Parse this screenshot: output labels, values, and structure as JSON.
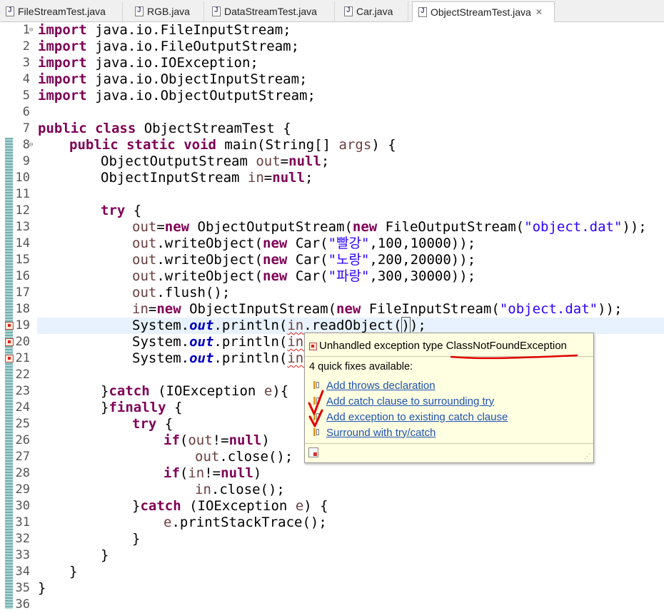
{
  "tabs": [
    {
      "label": "FileStreamTest.java",
      "active": false
    },
    {
      "label": "RGB.java",
      "active": false
    },
    {
      "label": "DataStreamTest.java",
      "active": false
    },
    {
      "label": "Car.java",
      "active": false
    },
    {
      "label": "ObjectStreamTest.java",
      "active": true,
      "close": "✕"
    }
  ],
  "line_numbers": [
    "1",
    "2",
    "3",
    "4",
    "5",
    "6",
    "7",
    "8",
    "9",
    "10",
    "11",
    "12",
    "13",
    "14",
    "15",
    "16",
    "17",
    "18",
    "19",
    "20",
    "21",
    "22",
    "23",
    "24",
    "25",
    "26",
    "27",
    "28",
    "29",
    "30",
    "31",
    "32",
    "33",
    "34",
    "35",
    "36"
  ],
  "code": {
    "l1": [
      "import",
      " java.io.FileInputStream;"
    ],
    "l2": [
      "import",
      " java.io.FileOutputStream;"
    ],
    "l3": [
      "import",
      " java.io.IOException;"
    ],
    "l4": [
      "import",
      " java.io.ObjectInputStream;"
    ],
    "l5": [
      "import",
      " java.io.ObjectOutputStream;"
    ],
    "l7": [
      "public",
      "class",
      " ObjectStreamTest {"
    ],
    "l8": [
      "public",
      "static",
      "void",
      " main(String[] ",
      "args",
      ") {"
    ],
    "l9": [
      "ObjectOutputStream ",
      "out",
      "=",
      "null",
      ";"
    ],
    "l10": [
      "ObjectInputStream ",
      "in",
      "=",
      "null",
      ";"
    ],
    "l12": [
      "try",
      " {"
    ],
    "l13": [
      "out",
      "=",
      "new",
      " ObjectOutputStream(",
      "new",
      " FileOutputStream(",
      "\"object.dat\"",
      "));"
    ],
    "l14": [
      "out",
      ".writeObject(",
      "new",
      " Car(",
      "\"빨강\"",
      ",100,10000));"
    ],
    "l15": [
      "out",
      ".writeObject(",
      "new",
      " Car(",
      "\"노랑\"",
      ",200,20000));"
    ],
    "l16": [
      "out",
      ".writeObject(",
      "new",
      " Car(",
      "\"파랑\"",
      ",300,30000));"
    ],
    "l17": [
      "out",
      ".flush();"
    ],
    "l18": [
      "in",
      "=",
      "new",
      " ObjectInputStream(",
      "new",
      " FileInputStream(",
      "\"object.dat\"",
      "));"
    ],
    "l19": [
      "System.",
      "out",
      ".println(",
      "in",
      ".readObject(",
      ")",
      ");"
    ],
    "l20": [
      "System.",
      "out",
      ".println(",
      "in."
    ],
    "l21": [
      "System.",
      "out",
      ".println(",
      "in."
    ],
    "l23": [
      "}",
      "catch",
      " (IOException ",
      "e",
      "){"
    ],
    "l24": [
      "}",
      "finally",
      " {"
    ],
    "l25": [
      "try",
      " {"
    ],
    "l26": [
      "if",
      "(",
      "out",
      "!=",
      "null",
      ")"
    ],
    "l27": [
      "out",
      ".close();"
    ],
    "l28": [
      "if",
      "(",
      "in",
      "!=",
      "null",
      ")"
    ],
    "l29": [
      "in",
      ".close();"
    ],
    "l30": [
      "}",
      "catch",
      " (IOException ",
      "e",
      ") {"
    ],
    "l31": [
      "e",
      ".printStackTrace();"
    ],
    "l32": [
      "}"
    ],
    "l33": [
      "}"
    ],
    "l34": [
      "}"
    ],
    "l35": [
      "}"
    ]
  },
  "popup": {
    "title_prefix": "Unhandled exception type ",
    "title_type": "ClassNotFoundException",
    "subtitle": "4 quick fixes available:",
    "fixes": [
      "Add throws declaration",
      "Add catch clause to surrounding try",
      "Add exception to existing catch clause",
      "Surround with try/catch"
    ],
    "grip": "⋰"
  },
  "colors": {
    "keyword": "#7f0055",
    "string": "#2a00ff",
    "field": "#0000c0",
    "local_var": "#6a3e3e",
    "popup_bg": "#ffffe1",
    "link": "#1f52b5",
    "annotation": "#e00000"
  },
  "icons": {
    "tab": "java-file-icon",
    "gutter_error": "error-marker-icon",
    "quick_fix": "quick-fix-icon",
    "popup_footer": "preferences-icon"
  }
}
